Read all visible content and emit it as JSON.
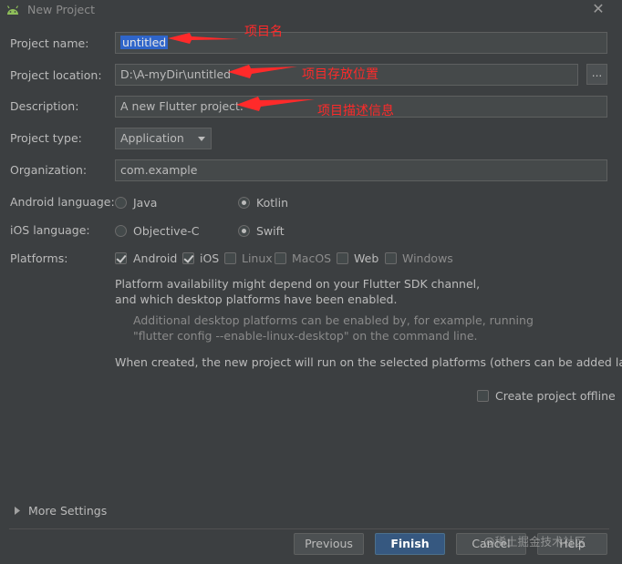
{
  "window": {
    "title": "New Project"
  },
  "form": {
    "project_name": {
      "label": "Project name:",
      "value": "untitled"
    },
    "project_location": {
      "label": "Project location:",
      "value": "D:\\A-myDir\\untitled",
      "browse_label": "..."
    },
    "description": {
      "label": "Description:",
      "value": "A new Flutter project."
    },
    "project_type": {
      "label": "Project type:",
      "value": "Application"
    },
    "organization": {
      "label": "Organization:",
      "value": "com.example"
    },
    "android_language": {
      "label": "Android language:",
      "options": [
        "Java",
        "Kotlin"
      ],
      "selected": "Kotlin"
    },
    "ios_language": {
      "label": "iOS language:",
      "options": [
        "Objective-C",
        "Swift"
      ],
      "selected": "Swift"
    },
    "platforms": {
      "label": "Platforms:",
      "items": [
        {
          "label": "Android",
          "checked": true
        },
        {
          "label": "iOS",
          "checked": true
        },
        {
          "label": "Linux",
          "checked": false
        },
        {
          "label": "MacOS",
          "checked": false
        },
        {
          "label": "Web",
          "checked": false
        },
        {
          "label": "Windows",
          "checked": false
        }
      ]
    },
    "info": {
      "line1": "Platform availability might depend on your Flutter SDK channel,",
      "line2": "and which desktop platforms have been enabled.",
      "hint1": "Additional desktop platforms can be enabled by, for example, running",
      "hint2": "\"flutter config --enable-linux-desktop\" on the command line.",
      "created": "When created, the new project will run on the selected platforms (others can be added later)."
    },
    "offline": {
      "label": "Create project offline",
      "checked": false
    }
  },
  "more_settings": {
    "label": "More Settings"
  },
  "buttons": {
    "previous": "Previous",
    "finish": "Finish",
    "cancel": "Cancel",
    "help": "Help"
  },
  "annotations": {
    "name": "项目名",
    "location": "项目存放位置",
    "description": "项目描述信息",
    "color": "#ff2a2a"
  },
  "watermark": "@稀土掘金技术社区"
}
